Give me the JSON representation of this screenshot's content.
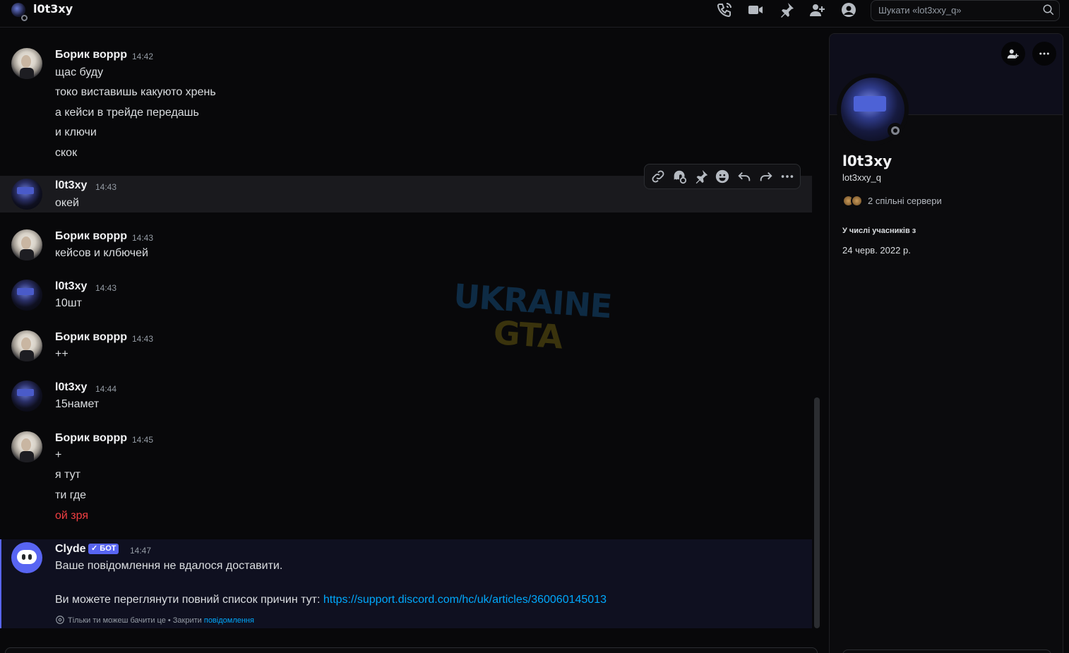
{
  "header": {
    "title": "l0t3xy",
    "search_placeholder": "Шукати «lot3xxy_q»",
    "icons": [
      "phone-call-icon",
      "video-icon",
      "pin-icon",
      "add-friends-icon",
      "profile-toggle-icon",
      "search-icon"
    ]
  },
  "messages": [
    {
      "author": "Борик воррр",
      "time": "14:42",
      "avatar": "borik",
      "lines": [
        "щас буду",
        "токо виставишь какуюто хрень",
        "а кейси в трейде передашь",
        "и ключи",
        "скок"
      ]
    },
    {
      "author": "l0t3xy",
      "time": "14:43",
      "avatar": "lot",
      "lines": [
        "окей"
      ]
    },
    {
      "author": "Борик воррр",
      "time": "14:43",
      "avatar": "borik",
      "lines": [
        "кейсов и клбючей"
      ]
    },
    {
      "author": "l0t3xy",
      "time": "14:43",
      "avatar": "lot",
      "lines": [
        "10шт"
      ]
    },
    {
      "author": "Борик воррр",
      "time": "14:43",
      "avatar": "borik",
      "lines": [
        "++"
      ]
    },
    {
      "author": "l0t3xy",
      "time": "14:44",
      "avatar": "lot",
      "lines": [
        "15намет"
      ]
    },
    {
      "author": "Борик воррр",
      "time": "14:45",
      "avatar": "borik",
      "lines": [
        "+",
        "я тут",
        "ти где",
        "ой зря"
      ]
    }
  ],
  "clyde": {
    "author": "Clyde",
    "badge": "БОТ",
    "time": "14:47",
    "line1": "Ваше повідомлення не вдалося доставити.",
    "line2_prefix": "Ви можете переглянути повний список причин тут: ",
    "line2_link": "https://support.discord.com/hc/uk/articles/360060145013",
    "ephemeral_text": "Тільки ти можеш бачити це • Закрити ",
    "ephemeral_dismiss": "повідомлення"
  },
  "toolbar": {
    "icons": [
      "copy-link-icon",
      "add-reaction-icon",
      "pin-message-icon",
      "emoji-icon",
      "reply-icon",
      "forward-icon",
      "more-icon"
    ]
  },
  "watermark": {
    "line1": "UKRAINE",
    "line2": "GTA"
  },
  "profile": {
    "display_name": "l0t3xy",
    "username": "lot3xxy_q",
    "mutual_servers": "2 спільні сервери",
    "member_since_label": "У числі учасників з",
    "member_since": "24 черв. 2022 р."
  },
  "colors": {
    "background": "#08080a",
    "accent": "#5865f2",
    "link": "#00a8fc",
    "danger": "#f23f42"
  }
}
